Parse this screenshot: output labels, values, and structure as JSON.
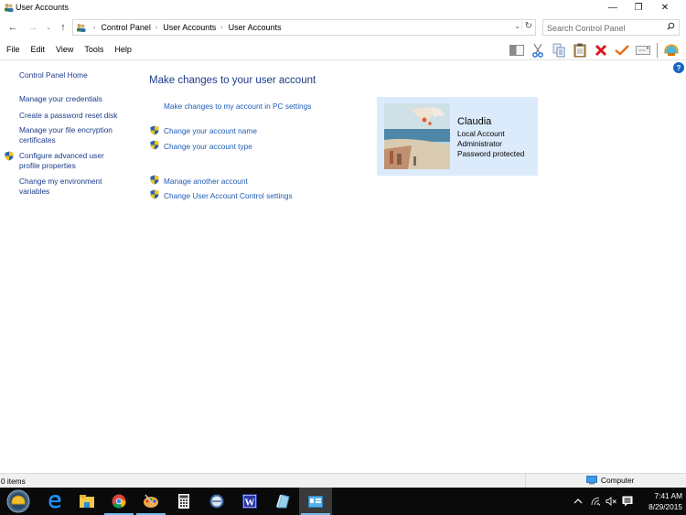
{
  "window": {
    "title": "User Accounts",
    "controls": {
      "minimize": "—",
      "restore": "❐",
      "close": "✕"
    }
  },
  "nav": {
    "back_icon": "←",
    "forward_icon": "→",
    "recent_icon": "⌄",
    "up_icon": "↑",
    "breadcrumbs": [
      "Control Panel",
      "User Accounts",
      "User Accounts"
    ],
    "crumb_separator": "›",
    "dropdown_icon": "⌄",
    "refresh_icon": "↻",
    "search_placeholder": "Search Control Panel",
    "search_icon": "⚲"
  },
  "menu": [
    "File",
    "Edit",
    "View",
    "Tools",
    "Help"
  ],
  "toolbar": {
    "icons": [
      "layout-pane-icon",
      "cut-icon",
      "copy-icon",
      "paste-icon",
      "delete-icon",
      "check-icon",
      "email-icon",
      "shell-icon"
    ],
    "help_label": "?"
  },
  "left_pane": {
    "home": "Control Panel Home",
    "items": [
      {
        "label_lines": [
          "Manage your credentials"
        ],
        "shield": false
      },
      {
        "label_lines": [
          "Create a password reset disk"
        ],
        "shield": false
      },
      {
        "label_lines": [
          "Manage your file encryption",
          "certificates"
        ],
        "shield": false
      },
      {
        "label_lines": [
          "Configure advanced user",
          "profile properties"
        ],
        "shield": true
      },
      {
        "label_lines": [
          "Change my environment",
          "variables"
        ],
        "shield": false
      }
    ]
  },
  "main": {
    "title": "Make changes to your user account",
    "pc_settings_link": "Make changes to my account in PC settings",
    "links_group1": [
      "Change your account name",
      "Change your account type"
    ],
    "links_group2": [
      "Manage another account",
      "Change User Account Control settings"
    ]
  },
  "user": {
    "name": "Claudia",
    "details": [
      "Local Account",
      "Administrator",
      "Password protected"
    ]
  },
  "status": {
    "items": "0 items",
    "location": "Computer"
  },
  "taskbar": {
    "apps": [
      "start-shell",
      "edge",
      "file-explorer",
      "chrome",
      "paint",
      "calculator",
      "clock-app",
      "word",
      "notepad",
      "control-panel"
    ],
    "time": "7:41 AM",
    "date": "8/29/2015",
    "tray_chevron": "^",
    "volume_icon": "🔇"
  },
  "colors": {
    "link": "#1c5cb5",
    "heading": "#1e3a8a",
    "tile_bg": "#dcebfb",
    "taskbar": "#0a0a0a",
    "accent": "#76b9ed"
  }
}
